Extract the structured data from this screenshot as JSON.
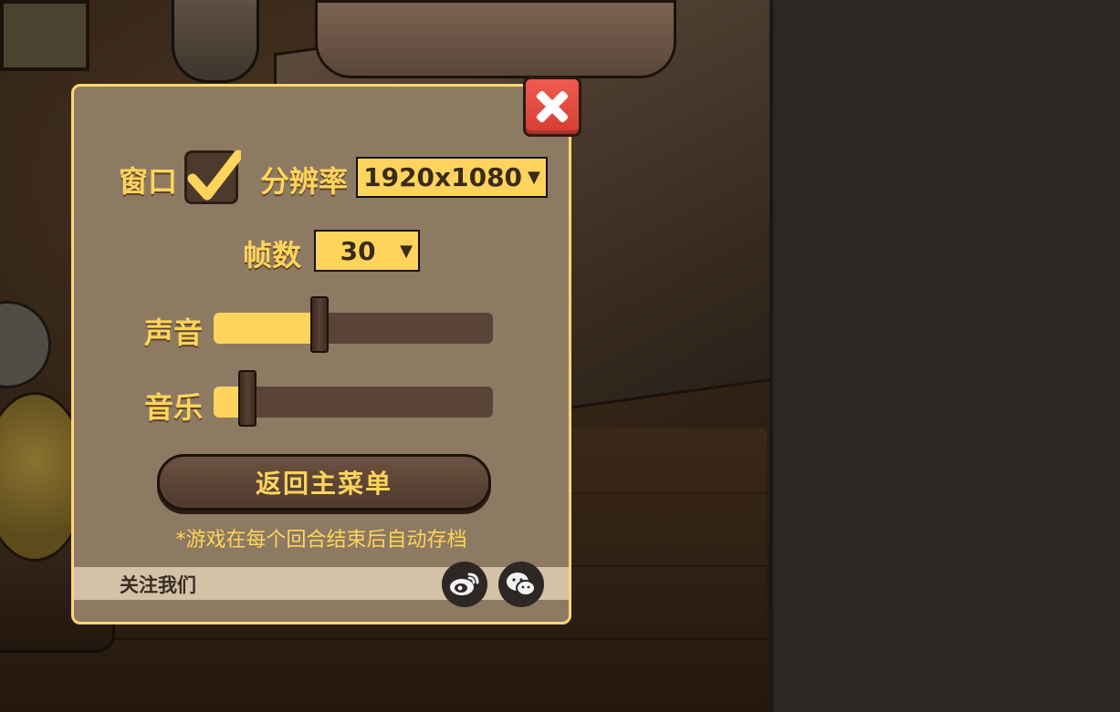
{
  "settings": {
    "window_label": "窗口",
    "window_checked": true,
    "resolution_label": "分辨率",
    "resolution_value": "1920x1080",
    "fps_label": "帧数",
    "fps_value": "30",
    "sound_label": "声音",
    "sound_level": 0.38,
    "music_label": "音乐",
    "music_level": 0.12,
    "main_menu_button": "返回主菜单",
    "autosave_note": "*游戏在每个回合结束后自动存档"
  },
  "footer": {
    "follow_label": "关注我们",
    "icons": [
      "weibo-icon",
      "wechat-icon"
    ]
  },
  "colors": {
    "accent": "#ffd45c",
    "panel": "#8d7a62",
    "close": "#e34b41"
  }
}
